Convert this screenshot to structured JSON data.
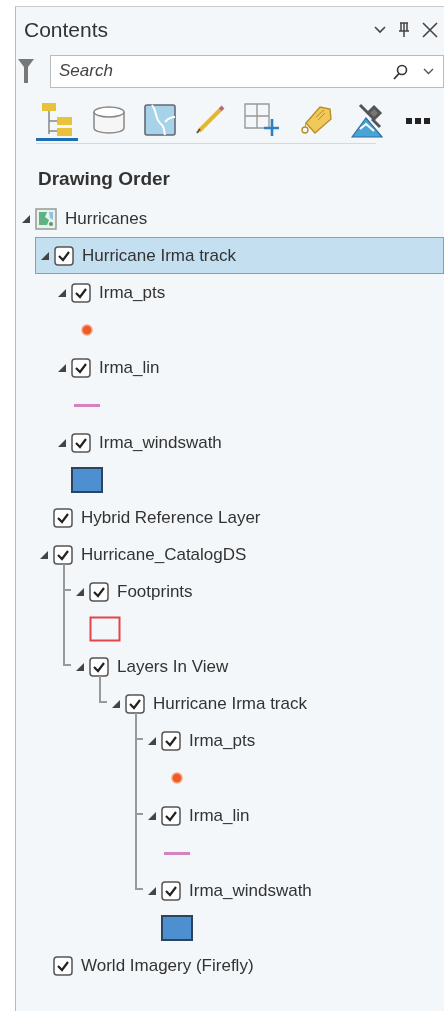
{
  "panel": {
    "title": "Contents"
  },
  "search": {
    "placeholder": "Search"
  },
  "tabs": [
    {
      "kind": "drawing-order",
      "selected": true
    },
    {
      "kind": "data-source",
      "selected": false
    },
    {
      "kind": "selection",
      "selected": false
    },
    {
      "kind": "editing",
      "selected": false
    },
    {
      "kind": "snapping",
      "selected": false
    },
    {
      "kind": "labeling",
      "selected": false
    },
    {
      "kind": "perspective",
      "selected": false
    }
  ],
  "heading": "Drawing Order",
  "layers": [
    {
      "label": "Hurricanes",
      "kind": "map",
      "expanded": true,
      "selected": false,
      "children": [
        {
          "label": "Hurricane Irma track",
          "checked": true,
          "expanded": true,
          "selected": true,
          "guides": false,
          "children": [
            {
              "label": "Irma_pts",
              "checked": true,
              "expanded": true,
              "selected": false,
              "symbol": {
                "kind": "point"
              }
            },
            {
              "label": "Irma_lin",
              "checked": true,
              "expanded": true,
              "selected": false,
              "symbol": {
                "kind": "line"
              }
            },
            {
              "label": "Irma_windswath",
              "checked": true,
              "expanded": true,
              "selected": false,
              "symbol": {
                "kind": "polygon"
              }
            }
          ]
        },
        {
          "label": "Hybrid Reference Layer",
          "checked": true,
          "selected": false
        },
        {
          "label": "Hurricane_CatalogDS",
          "checked": true,
          "expanded": true,
          "selected": false,
          "guides": true,
          "children": [
            {
              "label": "Footprints",
              "checked": true,
              "expanded": true,
              "selected": false,
              "symbol": {
                "kind": "outline"
              }
            },
            {
              "label": "Layers In View",
              "checked": true,
              "expanded": true,
              "selected": false,
              "guides": true,
              "children": [
                {
                  "label": "Hurricane Irma track",
                  "checked": true,
                  "expanded": true,
                  "selected": false,
                  "guides": true,
                  "children": [
                    {
                      "label": "Irma_pts",
                      "checked": true,
                      "expanded": true,
                      "selected": false,
                      "symbol": {
                        "kind": "point"
                      }
                    },
                    {
                      "label": "Irma_lin",
                      "checked": true,
                      "expanded": true,
                      "selected": false,
                      "symbol": {
                        "kind": "line"
                      }
                    },
                    {
                      "label": "Irma_windswath",
                      "checked": true,
                      "expanded": true,
                      "selected": false,
                      "symbol": {
                        "kind": "polygon"
                      }
                    }
                  ]
                }
              ]
            }
          ]
        },
        {
          "label": "World Imagery (Firefly)",
          "checked": true,
          "selected": false
        }
      ]
    }
  ]
}
